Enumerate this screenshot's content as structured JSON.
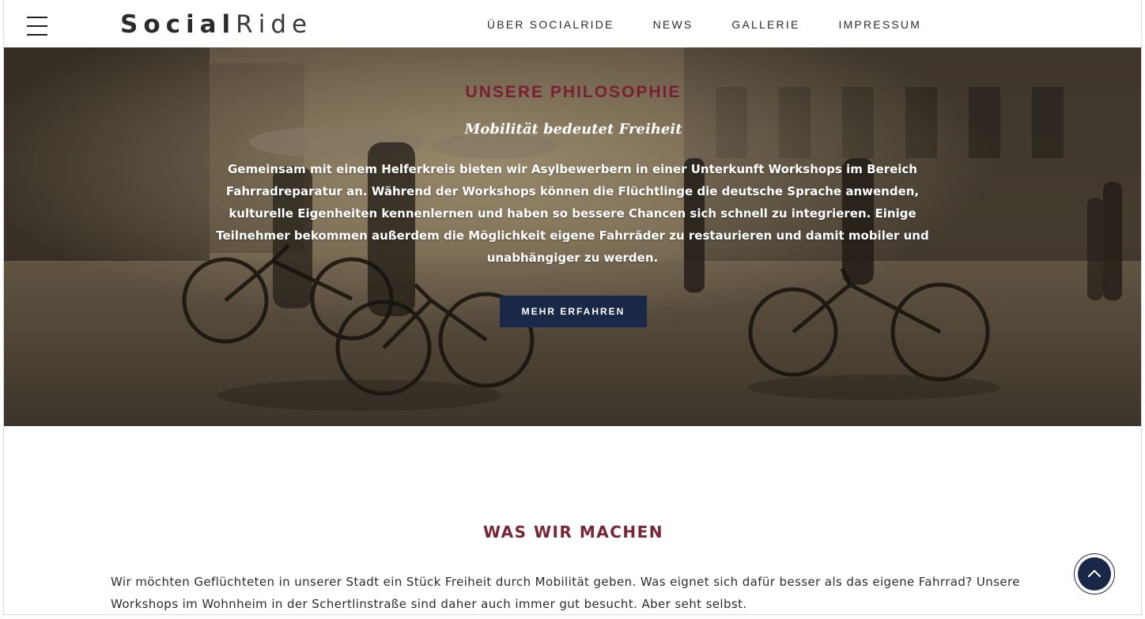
{
  "brand": {
    "name_bold": "Social",
    "name_light": "Ride"
  },
  "nav": {
    "items": [
      {
        "label": "ÜBER SOCIALRIDE"
      },
      {
        "label": "NEWS"
      },
      {
        "label": "GALLERIE"
      },
      {
        "label": "IMPRESSUM"
      }
    ],
    "menu_icon": "hamburger-icon"
  },
  "hero": {
    "kicker": "UNSERE PHILOSOPHIE",
    "subtitle": "Mobilität bedeutet Freiheit",
    "text": "Gemeinsam mit einem Helferkreis bieten wir Asylbewerbern in einer Unterkunft Workshops im Bereich Fahrradreparatur an. Während der Workshops können die Flüchtlinge die deutsche Sprache anwenden, kulturelle Eigenheiten kennenlernen und haben so bessere Chancen sich schnell zu integrieren. Einige Teilnehmer bekommen außerdem die Möglichkeit eigene Fahrräder zu restaurieren und damit mobiler und unabhängiger zu werden.",
    "button_label": "MEHR ERFAHREN"
  },
  "section": {
    "title": "WAS WIR MACHEN",
    "text": "Wir möchten Geflüchteten in unserer Stadt ein Stück Freiheit durch Mobilität geben. Was eignet sich dafür besser als das eigene Fahrrad? Unsere Workshops im Wohnheim in der Schertlinstraße sind daher auch immer gut besucht. Aber seht selbst."
  },
  "scroll_top": {
    "icon": "chevron-up-icon"
  },
  "colors": {
    "accent": "#7a2436",
    "button": "#1a2848",
    "text": "#2c2c2c"
  }
}
